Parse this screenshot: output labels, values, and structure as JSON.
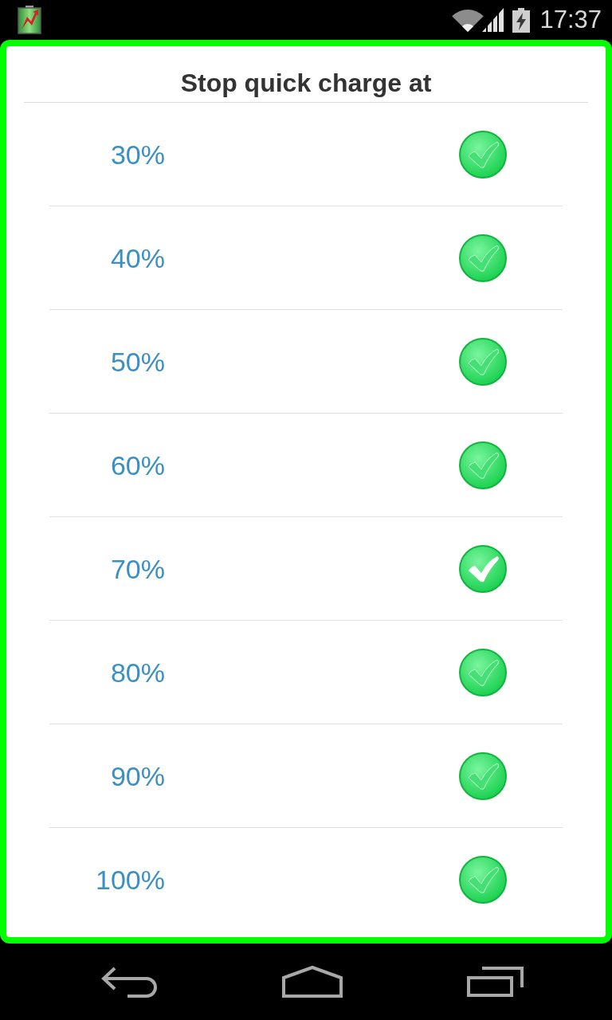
{
  "status_bar": {
    "time": "17:37"
  },
  "dialog": {
    "title": "Stop quick charge at",
    "options": [
      {
        "label": "30%",
        "selected": false
      },
      {
        "label": "40%",
        "selected": false
      },
      {
        "label": "50%",
        "selected": false
      },
      {
        "label": "60%",
        "selected": false
      },
      {
        "label": "70%",
        "selected": true
      },
      {
        "label": "80%",
        "selected": false
      },
      {
        "label": "90%",
        "selected": false
      },
      {
        "label": "100%",
        "selected": false
      }
    ]
  }
}
